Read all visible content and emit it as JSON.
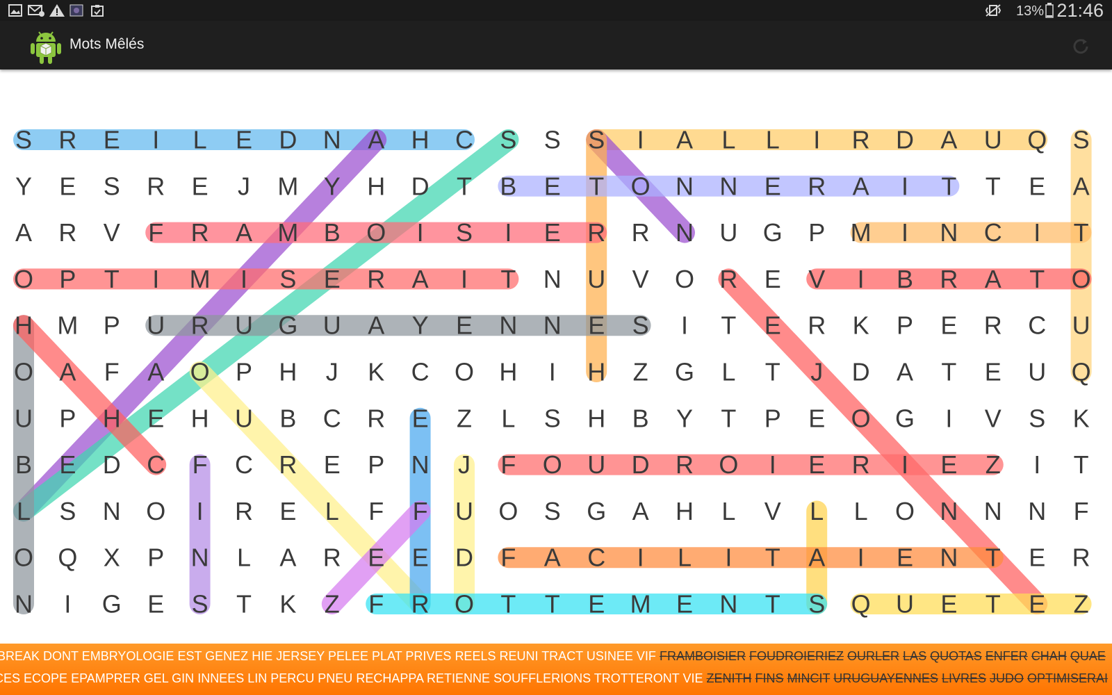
{
  "status_bar": {
    "battery": "13%",
    "time": "21:46",
    "icons": [
      "image-icon",
      "mail-icon",
      "warning-icon",
      "app-thumbnail-icon",
      "clipboard-icon",
      "vibrate-icon",
      "battery-icon"
    ]
  },
  "app": {
    "title": "Mots Mêlés",
    "icon": "android-robot-icon",
    "action": "refresh-icon"
  },
  "grid": {
    "rows": [
      "SREILEDNAHCSSSIALLIRDAUQS",
      "YESREJMYHDTBETONNERAITTEA",
      "ARVFRAMBOISIERRNUGPMINCIT",
      "OPTIMISERAITNUVOREVIBRATO",
      "HMPURUGUAYENNESITERKPERCU",
      "OAFAOPHJKCOHIHZGLTJDATEUQ",
      "UPHEHUBCREZLSHBYTPEOGIVSK",
      "BEDCFCREPNJFOUDROIERIEZIT",
      "LSNOIRELFFUOSGAHLVLLONNNF",
      "OQXPNLAREEDFACILITAIENTER",
      "NIGESTKZFROTTEMENTSQUETEZ"
    ],
    "highlights": [
      {
        "word": "CHANDELIERS",
        "from": [
          0,
          10
        ],
        "to": [
          0,
          0
        ],
        "color": "#63b8ee"
      },
      {
        "word": "QUADRILLAIS",
        "from": [
          0,
          23
        ],
        "to": [
          0,
          13
        ],
        "color": "#ffcc66"
      },
      {
        "word": "HEUREUSES",
        "from": [
          0,
          8
        ],
        "to": [
          8,
          0
        ],
        "color": "#9b4fd0"
      },
      {
        "word": "SOLIDES",
        "from": [
          0,
          11
        ],
        "to": [
          8,
          0
        ],
        "color": "#3ed6b0"
      },
      {
        "word": "SON",
        "from": [
          0,
          13
        ],
        "to": [
          2,
          15
        ],
        "color": "#9b4fd0"
      },
      {
        "word": "SERRUCH",
        "from": [
          0,
          13
        ],
        "to": [
          5,
          13
        ],
        "color": "#ffb04d"
      },
      {
        "word": "SATOUQ",
        "from": [
          0,
          24
        ],
        "to": [
          5,
          24
        ],
        "color": "#ffd27a"
      },
      {
        "word": "BETONNERAIT",
        "from": [
          1,
          11
        ],
        "to": [
          1,
          21
        ],
        "color": "#aab0ff"
      },
      {
        "word": "FRAMBOISIER",
        "from": [
          2,
          3
        ],
        "to": [
          2,
          13
        ],
        "color": "#ff6b78"
      },
      {
        "word": "MINCIT",
        "from": [
          2,
          19
        ],
        "to": [
          2,
          24
        ],
        "color": "#ffbb66"
      },
      {
        "word": "OPTIMISERAIT",
        "from": [
          3,
          0
        ],
        "to": [
          3,
          11
        ],
        "color": "#ff6b6b"
      },
      {
        "word": "VIBRATO",
        "from": [
          3,
          18
        ],
        "to": [
          3,
          24
        ],
        "color": "#ff6060"
      },
      {
        "word": "URUGUAYENNES",
        "from": [
          4,
          3
        ],
        "to": [
          4,
          14
        ],
        "color": "#8e959d"
      },
      {
        "word": "RJOIEZ",
        "from": [
          3,
          16
        ],
        "to": [
          10,
          23
        ],
        "color": "#ff5e5e"
      },
      {
        "word": "HOUBLON",
        "from": [
          4,
          0
        ],
        "to": [
          10,
          0
        ],
        "color": "#8e959d"
      },
      {
        "word": "HAHC",
        "from": [
          4,
          0
        ],
        "to": [
          7,
          3
        ],
        "color": "#ff5e5e"
      },
      {
        "word": "OURLER",
        "from": [
          5,
          4
        ],
        "to": [
          10,
          9
        ],
        "color": "#fff08a"
      },
      {
        "word": "ENFER",
        "from": [
          6,
          9
        ],
        "to": [
          10,
          9
        ],
        "color": "#4aa8ee"
      },
      {
        "word": "FINS",
        "from": [
          7,
          4
        ],
        "to": [
          10,
          4
        ],
        "color": "#b48ce6"
      },
      {
        "word": "JUDO",
        "from": [
          7,
          10
        ],
        "to": [
          10,
          10
        ],
        "color": "#fff08a"
      },
      {
        "word": "FOUDROIERIEZ",
        "from": [
          7,
          11
        ],
        "to": [
          7,
          22
        ],
        "color": "#ff6b6b"
      },
      {
        "word": "LAS",
        "from": [
          8,
          18
        ],
        "to": [
          10,
          18
        ],
        "color": "#ffd34d"
      },
      {
        "word": "FACILITAIENT",
        "from": [
          9,
          11
        ],
        "to": [
          9,
          22
        ],
        "color": "#ff8a3c"
      },
      {
        "word": "FROTTEMENTS",
        "from": [
          10,
          8
        ],
        "to": [
          10,
          18
        ],
        "color": "#34e2f2"
      },
      {
        "word": "ZEF",
        "from": [
          10,
          7
        ],
        "to": [
          8,
          9
        ],
        "color": "#d67cf0"
      },
      {
        "word": "QUETEZ",
        "from": [
          10,
          19
        ],
        "to": [
          10,
          24
        ],
        "color": "#ffdd55"
      }
    ]
  },
  "ticker": {
    "line1": [
      {
        "text": "BREAK",
        "found": false
      },
      {
        "text": "DONT",
        "found": false
      },
      {
        "text": "EMBRYOLOGIE",
        "found": false
      },
      {
        "text": "EST",
        "found": false
      },
      {
        "text": "GENEZ",
        "found": false
      },
      {
        "text": "HIE",
        "found": false
      },
      {
        "text": "JERSEY",
        "found": false
      },
      {
        "text": "PELEE",
        "found": false
      },
      {
        "text": "PLAT",
        "found": false
      },
      {
        "text": "PRIVES",
        "found": false
      },
      {
        "text": "REELS",
        "found": false
      },
      {
        "text": "REUNI",
        "found": false
      },
      {
        "text": "TRACT",
        "found": false
      },
      {
        "text": "USINEE",
        "found": false
      },
      {
        "text": "VIF",
        "found": false
      },
      {
        "text": "FRAMBOISIER",
        "found": true
      },
      {
        "text": "FOUDROIERIEZ",
        "found": true
      },
      {
        "text": "OURLER",
        "found": true
      },
      {
        "text": "LAS",
        "found": true
      },
      {
        "text": "QUOTAS",
        "found": true
      },
      {
        "text": "ENFER",
        "found": true
      },
      {
        "text": "CHAH",
        "found": true
      },
      {
        "text": "QUAE",
        "found": true
      }
    ],
    "line2": [
      {
        "text": "CES",
        "found": false
      },
      {
        "text": "ECOPE",
        "found": false
      },
      {
        "text": "EPAMPRER",
        "found": false
      },
      {
        "text": "GEL",
        "found": false
      },
      {
        "text": "GIN",
        "found": false
      },
      {
        "text": "INNEES",
        "found": false
      },
      {
        "text": "LIN",
        "found": false
      },
      {
        "text": "PERCU",
        "found": false
      },
      {
        "text": "PNEU",
        "found": false
      },
      {
        "text": "RECHAPPA",
        "found": false
      },
      {
        "text": "RETIENNE",
        "found": false
      },
      {
        "text": "SOUFFLERIONS",
        "found": false
      },
      {
        "text": "TROTTERONT",
        "found": false
      },
      {
        "text": "VIE",
        "found": false
      },
      {
        "text": "ZENITH",
        "found": true
      },
      {
        "text": "FINS",
        "found": true
      },
      {
        "text": "MINCIT",
        "found": true
      },
      {
        "text": "URUGUAYENNES",
        "found": true
      },
      {
        "text": "LIVRES",
        "found": true
      },
      {
        "text": "JUDO",
        "found": true
      },
      {
        "text": "OPTIMISERAI",
        "found": true
      }
    ]
  }
}
